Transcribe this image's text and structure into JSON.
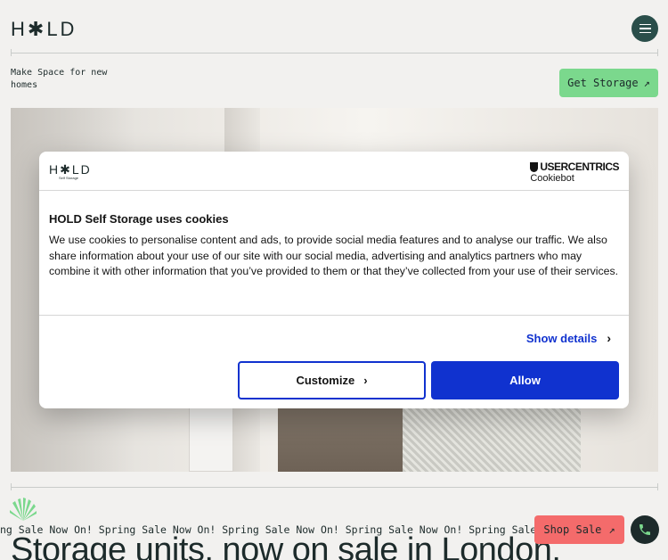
{
  "header": {
    "logo": "H✱LD",
    "menu_icon": "hamburger-icon"
  },
  "hero": {
    "tagline": "Make Space for new homes",
    "cta_label": "Get Storage",
    "cta_icon": "arrow-up-right-icon"
  },
  "cookie_dialog": {
    "logo": "H✱LD",
    "logo_sub": "Self Storage",
    "provider_top": "USERCENTRICS",
    "provider_bottom": "Cookiebot",
    "title": "HOLD Self Storage uses cookies",
    "text": "We use cookies to personalise content and ads, to provide social media features and to analyse our traffic. We also share information about your use of our site with our social media, advertising and analytics partners who may combine it with other information that you’ve provided to them or that they’ve collected from your use of their services.",
    "show_details": "Show details",
    "customize": "Customize",
    "allow": "Allow",
    "accent_color": "#1032cf"
  },
  "ticker": {
    "text": "ng Sale Now On! Spring Sale Now On! Spring Sale Now On! Spring Sale Now On! Spring Sale Now On! Spring Sale"
  },
  "headline": "Storage units, now on sale in London.",
  "floating": {
    "shop_sale": "Shop Sale",
    "phone_icon": "phone-icon"
  },
  "colors": {
    "brand_dark": "#2a4e4a",
    "green": "#7bd88d",
    "coral": "#f46b6b"
  }
}
